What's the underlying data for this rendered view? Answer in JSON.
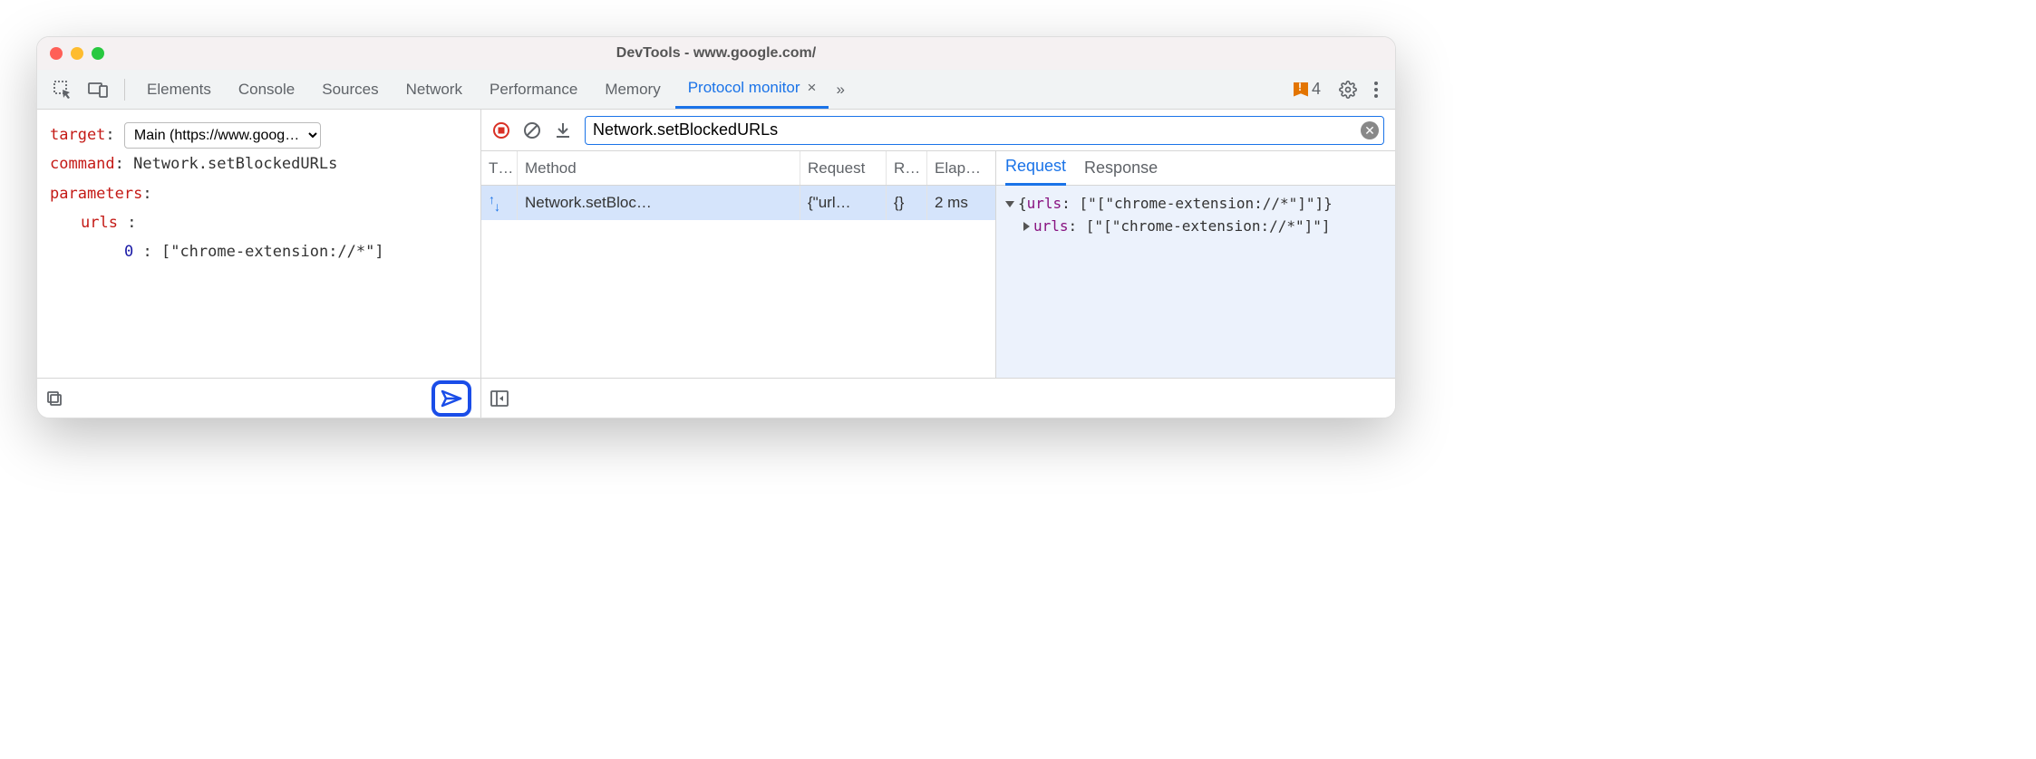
{
  "window": {
    "title": "DevTools - www.google.com/"
  },
  "tabs": {
    "items": [
      "Elements",
      "Console",
      "Sources",
      "Network",
      "Performance",
      "Memory",
      "Protocol monitor"
    ],
    "active": "Protocol monitor",
    "overflow": "»",
    "warning_count": "4"
  },
  "editor": {
    "target_label": "target",
    "target_value": "Main (https://www.goog…",
    "command_label": "command",
    "command_value": "Network.setBlockedURLs",
    "parameters_label": "parameters",
    "param_key": "urls",
    "param_index": "0",
    "param_value": "[\"chrome-extension://*\"]"
  },
  "filter": {
    "value": "Network.setBlockedURLs"
  },
  "log": {
    "headers": {
      "type": "T…",
      "method": "Method",
      "request": "Request",
      "response": "R…",
      "elapsed": "Elap…"
    },
    "row": {
      "method": "Network.setBloc…",
      "request": "{\"url…",
      "response": "{}",
      "elapsed": "2 ms"
    }
  },
  "details": {
    "tabs": {
      "request": "Request",
      "response": "Response"
    },
    "line1_key": "urls",
    "line1_val": "[\"[\"chrome-extension://*\"]\"]",
    "line2_key": "urls",
    "line2_val": "[\"[\"chrome-extension://*\"]\"]"
  }
}
